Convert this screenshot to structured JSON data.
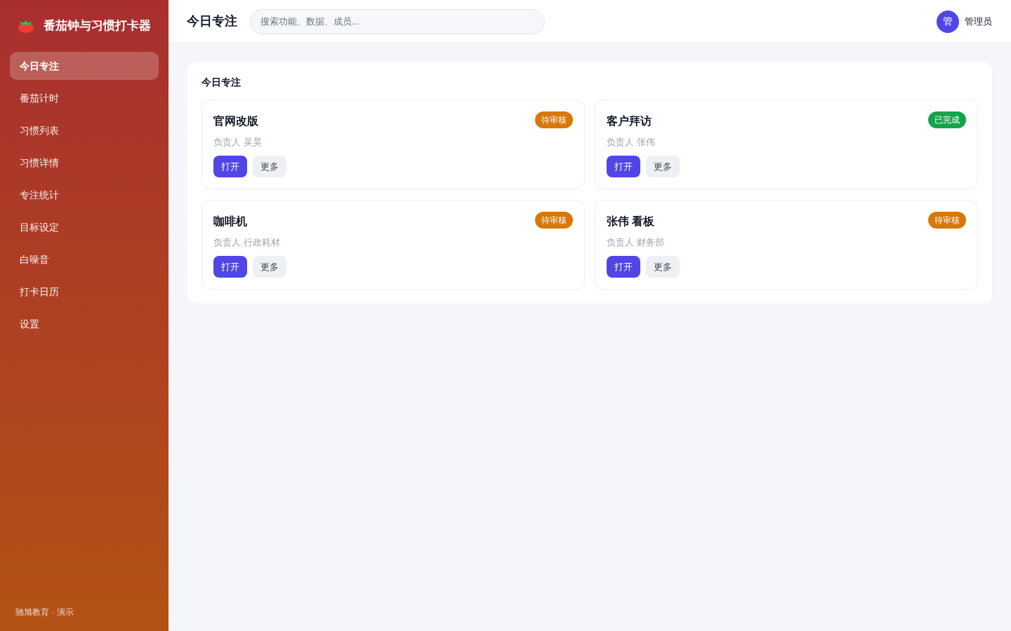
{
  "app": {
    "title": "番茄钟与习惯打卡器"
  },
  "sidebar": {
    "items": [
      {
        "label": "今日专注",
        "selected": true
      },
      {
        "label": "番茄计时",
        "selected": false
      },
      {
        "label": "习惯列表",
        "selected": false
      },
      {
        "label": "习惯详情",
        "selected": false
      },
      {
        "label": "专注统计",
        "selected": false
      },
      {
        "label": "目标设定",
        "selected": false
      },
      {
        "label": "白噪音",
        "selected": false
      },
      {
        "label": "打卡日历",
        "selected": false
      },
      {
        "label": "设置",
        "selected": false
      }
    ],
    "footer": "驰旭教育 · 演示"
  },
  "topbar": {
    "title": "今日专注",
    "search": {
      "placeholder": "搜索功能、数据、成员..."
    },
    "user": {
      "avatar": "管",
      "name": "管理员"
    }
  },
  "panel": {
    "title": "今日专注",
    "cards": [
      {
        "title": "官网改版",
        "owner": "负责人 吴昊",
        "status": {
          "label": "待审核",
          "color": "#d97706"
        },
        "actions": [
          {
            "label": "打开",
            "kind": "primary"
          },
          {
            "label": "更多",
            "kind": "secondary"
          }
        ]
      },
      {
        "title": "客户拜访",
        "owner": "负责人 张伟",
        "status": {
          "label": "已完成",
          "color": "#16a34a"
        },
        "actions": [
          {
            "label": "打开",
            "kind": "primary"
          },
          {
            "label": "更多",
            "kind": "secondary"
          }
        ]
      },
      {
        "title": "咖啡机",
        "owner": "负责人 行政耗材",
        "status": {
          "label": "待审核",
          "color": "#d97706"
        },
        "actions": [
          {
            "label": "打开",
            "kind": "primary"
          },
          {
            "label": "更多",
            "kind": "secondary"
          }
        ]
      },
      {
        "title": "张伟 看板",
        "owner": "负责人 财务部",
        "status": {
          "label": "待审核",
          "color": "#d97706"
        },
        "actions": [
          {
            "label": "打开",
            "kind": "primary"
          },
          {
            "label": "更多",
            "kind": "secondary"
          }
        ]
      }
    ]
  }
}
